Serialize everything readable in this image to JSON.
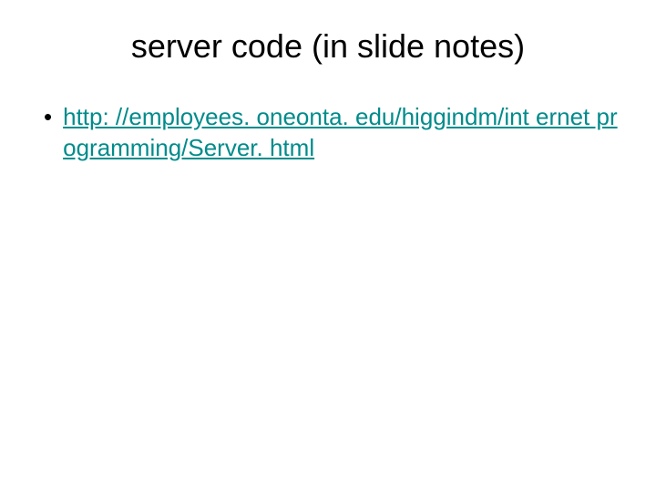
{
  "slide": {
    "title": "server code (in slide notes)",
    "bullets": [
      {
        "marker": "•",
        "link_text": "http: //employees. oneonta. edu/higgindm/int ernet programming/Server. html"
      }
    ]
  },
  "colors": {
    "link": "#008b8b",
    "text": "#000000",
    "background": "#ffffff"
  }
}
